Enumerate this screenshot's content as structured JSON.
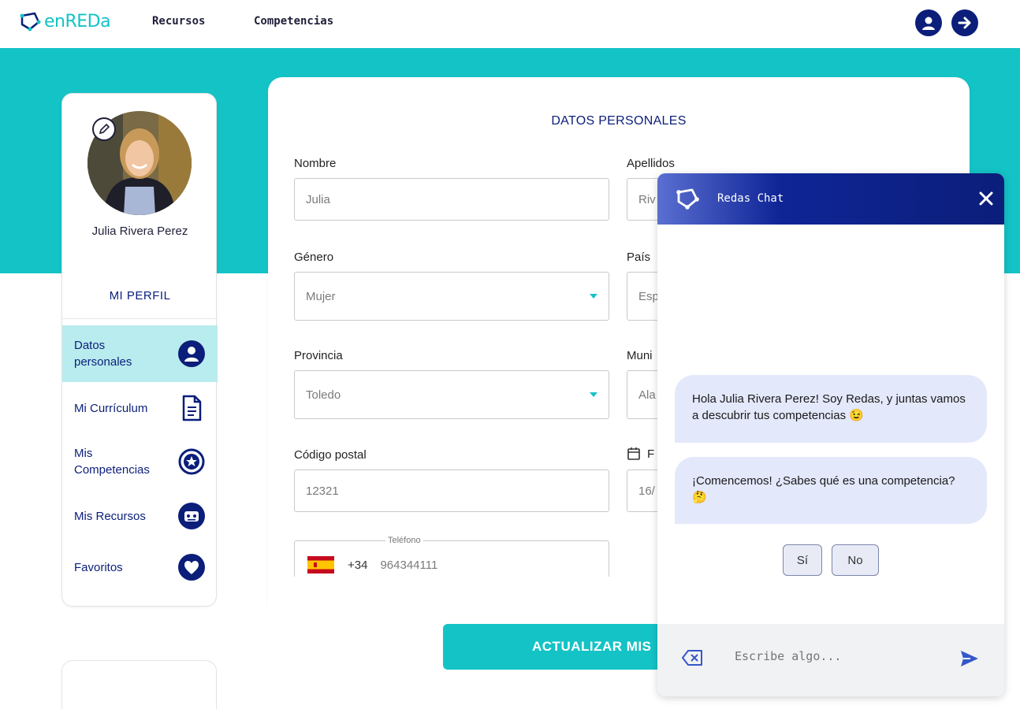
{
  "header": {
    "logo_text": "enREDa",
    "nav": [
      "Recursos",
      "Competencias"
    ]
  },
  "sidebar": {
    "user_name": "Julia Rivera Perez",
    "section_title": "MI PERFIL",
    "items": [
      {
        "label": "Datos personales",
        "icon": "user-circle-icon",
        "active": true
      },
      {
        "label": "Mi Currículum",
        "icon": "document-icon",
        "active": false
      },
      {
        "label": "Mis Competencias",
        "icon": "badge-star-icon",
        "active": false
      },
      {
        "label": "Mis Recursos",
        "icon": "robot-icon",
        "active": false
      },
      {
        "label": "Favoritos",
        "icon": "heart-icon",
        "active": false
      }
    ]
  },
  "form": {
    "title": "DATOS PERSONALES",
    "fields": {
      "nombre": {
        "label": "Nombre",
        "value": "Julia"
      },
      "apellidos": {
        "label": "Apellidos",
        "value": "Riv"
      },
      "genero": {
        "label": "Género",
        "value": "Mujer"
      },
      "pais": {
        "label": "País",
        "value": "Esp"
      },
      "provincia": {
        "label": "Provincia",
        "value": "Toledo"
      },
      "municipio": {
        "label": "Muni",
        "value": "Ala"
      },
      "codigo_postal": {
        "label": "Código postal",
        "value": "12321"
      },
      "fecha": {
        "label": "F",
        "value": "16/"
      },
      "telefono": {
        "label": "Teléfono",
        "prefix": "+34",
        "value": "964344111"
      }
    },
    "submit_label": "ACTUALIZAR MIS"
  },
  "chat": {
    "title": "Redas Chat",
    "messages": [
      "Hola Julia Rivera Perez! Soy Redas, y juntas vamos a descubrir tus competencias 😉",
      "¡Comencemos! ¿Sabes qué es una competencia? 🤔"
    ],
    "replies": [
      "Sí",
      "No"
    ],
    "input_placeholder": "Escribe algo..."
  },
  "colors": {
    "teal": "#14c3c6",
    "navy": "#0b1e7a",
    "active_item": "#b9ecee",
    "bubble": "#e3e8fb"
  }
}
